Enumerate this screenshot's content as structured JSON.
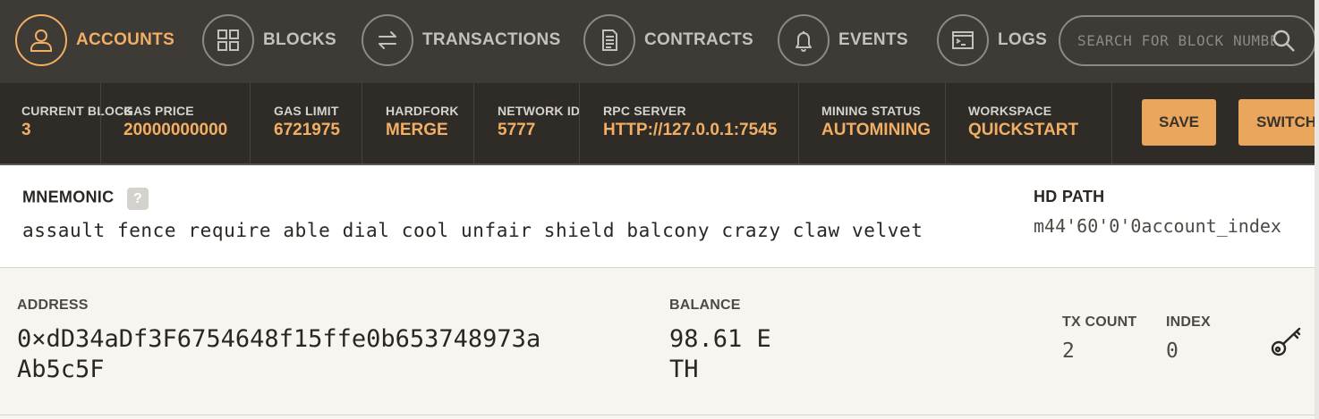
{
  "nav": {
    "accounts": "ACCOUNTS",
    "blocks": "BLOCKS",
    "transactions": "TRANSACTIONS",
    "contracts": "CONTRACTS",
    "events": "EVENTS",
    "logs": "LOGS",
    "search_placeholder": "SEARCH FOR BLOCK NUMBERS OR TX HASHES",
    "active_color": "#f2ae63"
  },
  "status": {
    "current_block": {
      "label": "CURRENT BLOCK",
      "value": "3"
    },
    "gas_price": {
      "label": "GAS PRICE",
      "value": "20000000000"
    },
    "gas_limit": {
      "label": "GAS LIMIT",
      "value": "6721975"
    },
    "hardfork": {
      "label": "HARDFORK",
      "value": "MERGE"
    },
    "network_id": {
      "label": "NETWORK ID",
      "value": "5777"
    },
    "rpc_server": {
      "label": "RPC SERVER",
      "value": "HTTP://127.0.0.1:7545"
    },
    "mining_status": {
      "label": "MINING STATUS",
      "value": "AUTOMINING"
    },
    "workspace": {
      "label": "WORKSPACE",
      "value": "QUICKSTART"
    },
    "save_label": "SAVE",
    "switch_label": "SWITCH"
  },
  "mnemonic": {
    "label": "MNEMONIC",
    "help": "?",
    "words": "assault fence require able dial cool unfair shield balcony crazy claw velvet",
    "hd_path_label": "HD PATH",
    "hd_path_value": "m44'60'0'0account_index"
  },
  "account": {
    "address_label": "ADDRESS",
    "address_line1": "0×dD34aDf3F6754648f15ffe0b653748973a",
    "address_line2": "Ab5c5F",
    "balance_label": "BALANCE",
    "balance_line1": "98.61 E",
    "balance_line2": "TH",
    "tx_count_label": "TX COUNT",
    "tx_count_value": "2",
    "index_label": "INDEX",
    "index_value": "0"
  }
}
